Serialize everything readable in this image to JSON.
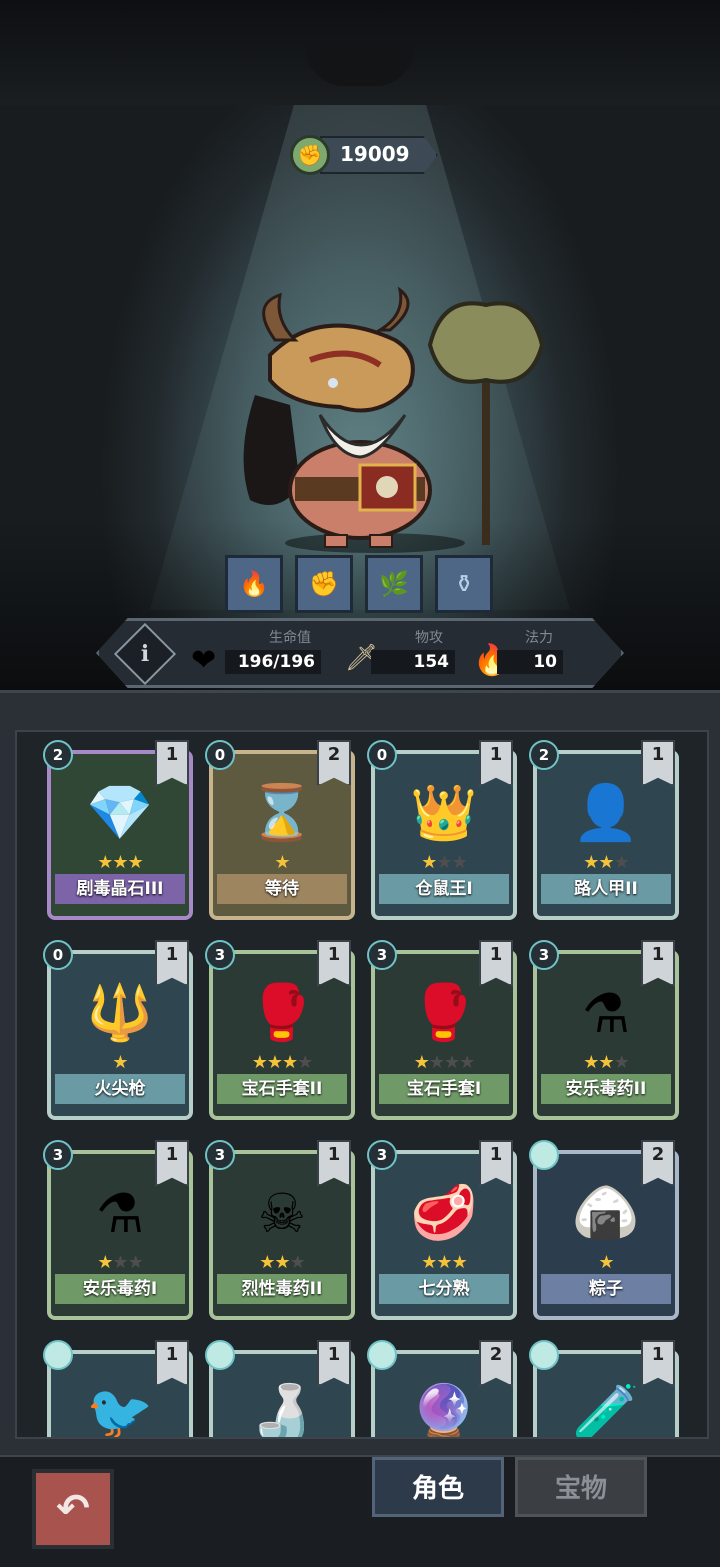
{
  "currency": {
    "icon": "fist-coin-icon",
    "amount": "19009"
  },
  "skills": [
    {
      "icon": "flame-meat-icon"
    },
    {
      "icon": "fist-icon"
    },
    {
      "icon": "laurel-icon"
    },
    {
      "icon": "potion-icon"
    }
  ],
  "stats": {
    "hp_label": "生命值",
    "hp_value": "196/196",
    "atk_label": "物攻",
    "atk_value": "154",
    "mana_label": "法力",
    "mana_value": "10",
    "info": "i"
  },
  "cards": [
    {
      "name": "剧毒晶石III",
      "cost": "2",
      "level": "1",
      "stars": 3,
      "max": 3,
      "rarity": "epic",
      "icon": "crystal-icon",
      "glyph": "💎"
    },
    {
      "name": "等待",
      "cost": "0",
      "level": "2",
      "stars": 1,
      "max": 1,
      "rarity": "common",
      "icon": "hourglass-icon",
      "glyph": "⌛"
    },
    {
      "name": "仓鼠王I",
      "cost": "0",
      "level": "1",
      "stars": 1,
      "max": 3,
      "rarity": "teal",
      "icon": "hamster-king-icon",
      "glyph": "👑"
    },
    {
      "name": "路人甲II",
      "cost": "2",
      "level": "1",
      "stars": 2,
      "max": 3,
      "rarity": "teal",
      "icon": "silhouette-icon",
      "glyph": "👤"
    },
    {
      "name": "火尖枪",
      "cost": "0",
      "level": "1",
      "stars": 1,
      "max": 1,
      "rarity": "teal",
      "icon": "spear-icon",
      "glyph": "🔱"
    },
    {
      "name": "宝石手套II",
      "cost": "3",
      "level": "1",
      "stars": 3,
      "max": 4,
      "rarity": "green",
      "icon": "gem-gauntlet-icon",
      "glyph": "🥊"
    },
    {
      "name": "宝石手套I",
      "cost": "3",
      "level": "1",
      "stars": 1,
      "max": 4,
      "rarity": "green",
      "icon": "gem-gauntlet-icon",
      "glyph": "🥊"
    },
    {
      "name": "安乐毒药II",
      "cost": "3",
      "level": "1",
      "stars": 2,
      "max": 3,
      "rarity": "green",
      "icon": "poison-flask-icon",
      "glyph": "⚗"
    },
    {
      "name": "安乐毒药I",
      "cost": "3",
      "level": "1",
      "stars": 1,
      "max": 3,
      "rarity": "green",
      "icon": "poison-flask-icon",
      "glyph": "⚗"
    },
    {
      "name": "烈性毒药II",
      "cost": "3",
      "level": "1",
      "stars": 2,
      "max": 3,
      "rarity": "green",
      "icon": "poison-mouth-icon",
      "glyph": "☠"
    },
    {
      "name": "七分熟",
      "cost": "3",
      "level": "1",
      "stars": 3,
      "max": 3,
      "rarity": "teal",
      "icon": "steak-icon",
      "glyph": "🥩"
    },
    {
      "name": "粽子",
      "cost": "",
      "level": "2",
      "stars": 1,
      "max": 1,
      "rarity": "blue",
      "icon": "zongzi-icon",
      "glyph": "🍙"
    },
    {
      "name": "",
      "cost": "",
      "level": "1",
      "stars": 0,
      "max": 0,
      "rarity": "teal",
      "icon": "crow-icon",
      "glyph": "🐦"
    },
    {
      "name": "",
      "cost": "",
      "level": "1",
      "stars": 0,
      "max": 0,
      "rarity": "teal",
      "icon": "crystal-bottle-icon",
      "glyph": "🍶"
    },
    {
      "name": "",
      "cost": "",
      "level": "2",
      "stars": 0,
      "max": 0,
      "rarity": "teal",
      "icon": "ice-orb-icon",
      "glyph": "🔮"
    },
    {
      "name": "",
      "cost": "",
      "level": "1",
      "stars": 0,
      "max": 0,
      "rarity": "teal",
      "icon": "ice-potion-icon",
      "glyph": "🧪"
    }
  ],
  "tabs": {
    "character": "角色",
    "treasure": "宝物"
  }
}
